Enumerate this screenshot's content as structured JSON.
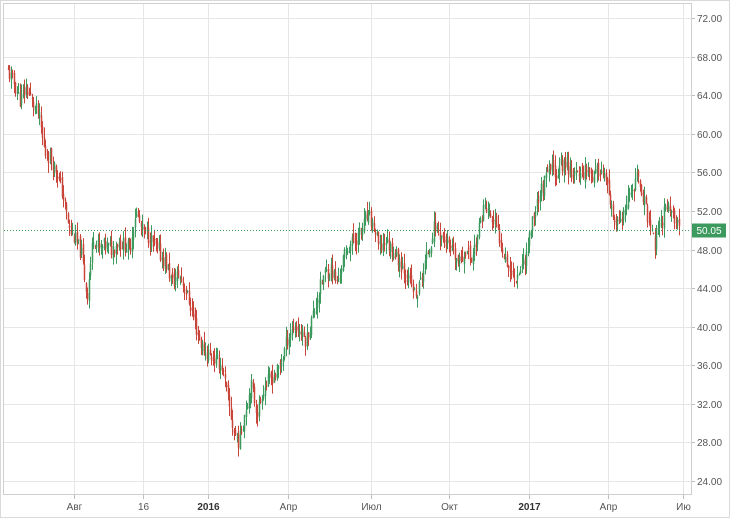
{
  "chart_data": {
    "type": "candlestick",
    "y_axis": {
      "side": "right",
      "ticks": [
        "72.00",
        "68.00",
        "64.00",
        "60.00",
        "56.00",
        "52.00",
        "48.00",
        "44.00",
        "40.00",
        "36.00",
        "32.00",
        "28.00",
        "24.00"
      ],
      "range": [
        22.5,
        73.5
      ]
    },
    "x_axis": {
      "ticks": [
        {
          "label": "Авг",
          "bold": false
        },
        {
          "label": "16",
          "bold": false
        },
        {
          "label": "2016",
          "bold": true
        },
        {
          "label": "Апр",
          "bold": false
        },
        {
          "label": "Июл",
          "bold": false
        },
        {
          "label": "Окт",
          "bold": false
        },
        {
          "label": "2017",
          "bold": true
        },
        {
          "label": "Апр",
          "bold": false
        },
        {
          "label": "Ию",
          "bold": false
        }
      ]
    },
    "grid": true,
    "last_price": {
      "label": "50.05",
      "value": 50.05,
      "color": "#3c9a5f"
    },
    "colors": {
      "up": "#3c9a5f",
      "down": "#c9453a"
    },
    "series": [
      {
        "t": 0,
        "v": 66.5
      },
      {
        "t": 0.9,
        "v": 65.2
      },
      {
        "t": 1.8,
        "v": 63.5
      },
      {
        "t": 2.7,
        "v": 64.8
      },
      {
        "t": 3.6,
        "v": 63.2
      },
      {
        "t": 4.5,
        "v": 62.0
      },
      {
        "t": 5.4,
        "v": 58.0
      },
      {
        "t": 6.3,
        "v": 57.5
      },
      {
        "t": 7.2,
        "v": 56.0
      },
      {
        "t": 8.1,
        "v": 53.5
      },
      {
        "t": 9.0,
        "v": 50.0
      },
      {
        "t": 9.9,
        "v": 49.0
      },
      {
        "t": 10.8,
        "v": 47.5
      },
      {
        "t": 11.6,
        "v": 43.0
      },
      {
        "t": 12.5,
        "v": 49.5
      },
      {
        "t": 13.4,
        "v": 48.0
      },
      {
        "t": 14.3,
        "v": 48.5
      },
      {
        "t": 15.2,
        "v": 48.0
      },
      {
        "t": 16.1,
        "v": 48.8
      },
      {
        "t": 17.0,
        "v": 48.5
      },
      {
        "t": 17.9,
        "v": 48.0
      },
      {
        "t": 18.8,
        "v": 52.0
      },
      {
        "t": 19.7,
        "v": 50.0
      },
      {
        "t": 20.6,
        "v": 49.5
      },
      {
        "t": 21.5,
        "v": 48.5
      },
      {
        "t": 22.4,
        "v": 47.5
      },
      {
        "t": 23.3,
        "v": 46.5
      },
      {
        "t": 24.2,
        "v": 44.5
      },
      {
        "t": 25.1,
        "v": 45.5
      },
      {
        "t": 26.0,
        "v": 44.0
      },
      {
        "t": 26.9,
        "v": 42.0
      },
      {
        "t": 27.8,
        "v": 39.5
      },
      {
        "t": 28.7,
        "v": 37.5
      },
      {
        "t": 29.6,
        "v": 37.0
      },
      {
        "t": 30.5,
        "v": 36.5
      },
      {
        "t": 31.4,
        "v": 36.0
      },
      {
        "t": 32.3,
        "v": 32.5
      },
      {
        "t": 33.2,
        "v": 29.0
      },
      {
        "t": 34.0,
        "v": 28.0
      },
      {
        "t": 34.9,
        "v": 31.5
      },
      {
        "t": 35.8,
        "v": 34.0
      },
      {
        "t": 36.7,
        "v": 31.0
      },
      {
        "t": 37.6,
        "v": 33.5
      },
      {
        "t": 38.5,
        "v": 34.5
      },
      {
        "t": 39.4,
        "v": 35.0
      },
      {
        "t": 40.3,
        "v": 36.5
      },
      {
        "t": 41.2,
        "v": 39.0
      },
      {
        "t": 42.1,
        "v": 40.0
      },
      {
        "t": 43.0,
        "v": 39.5
      },
      {
        "t": 43.9,
        "v": 38.5
      },
      {
        "t": 44.8,
        "v": 41.0
      },
      {
        "t": 45.7,
        "v": 43.5
      },
      {
        "t": 46.6,
        "v": 45.5
      },
      {
        "t": 47.5,
        "v": 46.0
      },
      {
        "t": 48.4,
        "v": 44.5
      },
      {
        "t": 49.3,
        "v": 47.0
      },
      {
        "t": 50.2,
        "v": 48.5
      },
      {
        "t": 51.1,
        "v": 49.0
      },
      {
        "t": 52.0,
        "v": 50.0
      },
      {
        "t": 52.9,
        "v": 51.5
      },
      {
        "t": 53.8,
        "v": 50.5
      },
      {
        "t": 54.7,
        "v": 48.0
      },
      {
        "t": 55.6,
        "v": 49.0
      },
      {
        "t": 56.5,
        "v": 48.0
      },
      {
        "t": 57.4,
        "v": 47.0
      },
      {
        "t": 58.3,
        "v": 46.0
      },
      {
        "t": 59.2,
        "v": 44.5
      },
      {
        "t": 60.1,
        "v": 43.0
      },
      {
        "t": 61.0,
        "v": 45.5
      },
      {
        "t": 61.9,
        "v": 48.0
      },
      {
        "t": 62.8,
        "v": 50.5
      },
      {
        "t": 63.7,
        "v": 49.5
      },
      {
        "t": 64.6,
        "v": 48.5
      },
      {
        "t": 65.5,
        "v": 47.5
      },
      {
        "t": 66.4,
        "v": 46.5
      },
      {
        "t": 67.3,
        "v": 48.0
      },
      {
        "t": 68.2,
        "v": 47.0
      },
      {
        "t": 69.1,
        "v": 49.5
      },
      {
        "t": 70.0,
        "v": 52.5
      },
      {
        "t": 70.9,
        "v": 51.5
      },
      {
        "t": 71.8,
        "v": 50.5
      },
      {
        "t": 72.7,
        "v": 48.5
      },
      {
        "t": 73.6,
        "v": 46.5
      },
      {
        "t": 74.5,
        "v": 45.0
      },
      {
        "t": 75.4,
        "v": 46.0
      },
      {
        "t": 76.3,
        "v": 47.5
      },
      {
        "t": 77.2,
        "v": 51.0
      },
      {
        "t": 78.1,
        "v": 53.5
      },
      {
        "t": 79.0,
        "v": 55.0
      },
      {
        "t": 79.9,
        "v": 56.5
      },
      {
        "t": 80.8,
        "v": 56.0
      },
      {
        "t": 81.7,
        "v": 57.0
      },
      {
        "t": 82.6,
        "v": 56.5
      },
      {
        "t": 83.5,
        "v": 55.5
      },
      {
        "t": 84.4,
        "v": 56.0
      },
      {
        "t": 85.3,
        "v": 56.5
      },
      {
        "t": 86.2,
        "v": 55.5
      },
      {
        "t": 87.1,
        "v": 56.5
      },
      {
        "t": 88.0,
        "v": 55.0
      },
      {
        "t": 88.9,
        "v": 51.5
      },
      {
        "t": 89.8,
        "v": 50.5
      },
      {
        "t": 90.7,
        "v": 51.5
      },
      {
        "t": 91.6,
        "v": 53.5
      },
      {
        "t": 92.5,
        "v": 55.5
      },
      {
        "t": 93.4,
        "v": 54.0
      },
      {
        "t": 94.3,
        "v": 51.0
      },
      {
        "t": 95.2,
        "v": 48.5
      },
      {
        "t": 96.1,
        "v": 50.5
      },
      {
        "t": 97.0,
        "v": 53.0
      },
      {
        "t": 97.9,
        "v": 51.5
      },
      {
        "t": 98.8,
        "v": 50.05
      }
    ]
  }
}
